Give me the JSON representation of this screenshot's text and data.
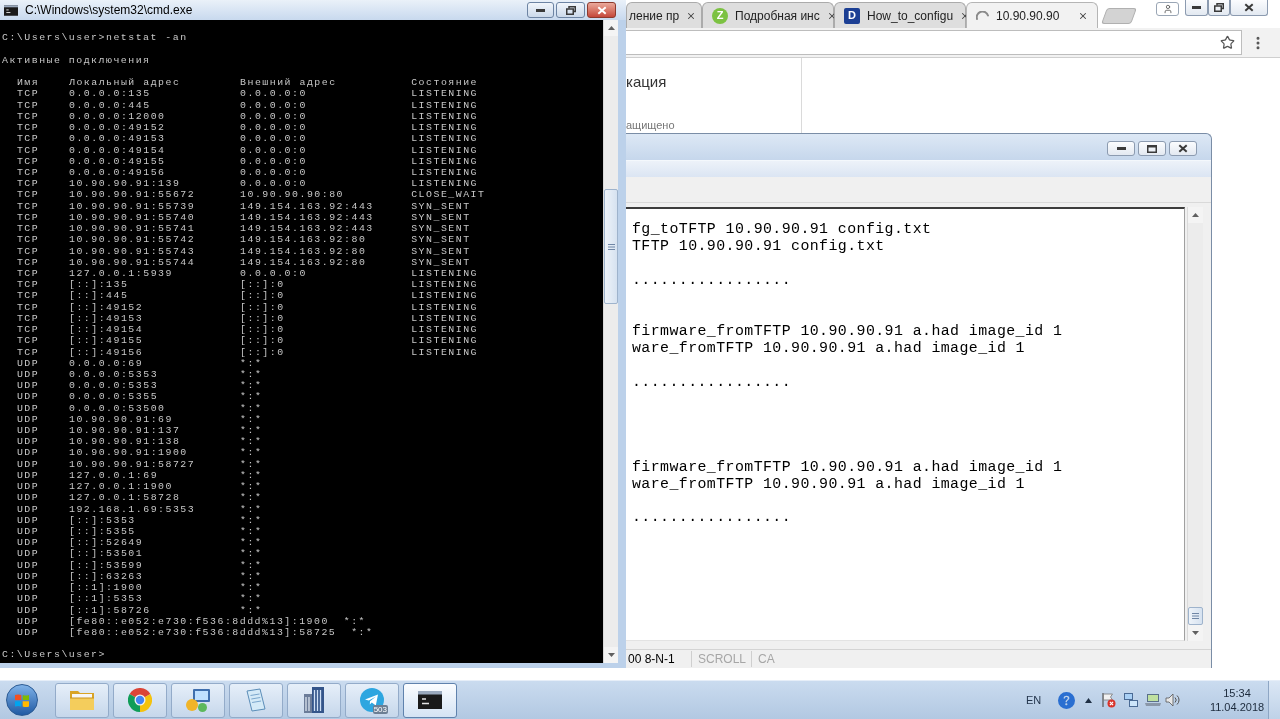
{
  "cmd_window": {
    "title": "C:\\Windows\\system32\\cmd.exe",
    "command": "C:\\Users\\user>netstat -an",
    "heading": "Активные подключения",
    "columns": [
      "Имя",
      "Локальный адрес",
      "Внешний адрес",
      "Состояние"
    ],
    "rows": [
      {
        "proto": "TCP",
        "local": "0.0.0.0:135",
        "foreign": "0.0.0.0:0",
        "state": "LISTENING"
      },
      {
        "proto": "TCP",
        "local": "0.0.0.0:445",
        "foreign": "0.0.0.0:0",
        "state": "LISTENING"
      },
      {
        "proto": "TCP",
        "local": "0.0.0.0:12000",
        "foreign": "0.0.0.0:0",
        "state": "LISTENING"
      },
      {
        "proto": "TCP",
        "local": "0.0.0.0:49152",
        "foreign": "0.0.0.0:0",
        "state": "LISTENING"
      },
      {
        "proto": "TCP",
        "local": "0.0.0.0:49153",
        "foreign": "0.0.0.0:0",
        "state": "LISTENING"
      },
      {
        "proto": "TCP",
        "local": "0.0.0.0:49154",
        "foreign": "0.0.0.0:0",
        "state": "LISTENING"
      },
      {
        "proto": "TCP",
        "local": "0.0.0.0:49155",
        "foreign": "0.0.0.0:0",
        "state": "LISTENING"
      },
      {
        "proto": "TCP",
        "local": "0.0.0.0:49156",
        "foreign": "0.0.0.0:0",
        "state": "LISTENING"
      },
      {
        "proto": "TCP",
        "local": "10.90.90.91:139",
        "foreign": "0.0.0.0:0",
        "state": "LISTENING"
      },
      {
        "proto": "TCP",
        "local": "10.90.90.91:55672",
        "foreign": "10.90.90.90:80",
        "state": "CLOSE_WAIT"
      },
      {
        "proto": "TCP",
        "local": "10.90.90.91:55739",
        "foreign": "149.154.163.92:443",
        "state": "SYN_SENT"
      },
      {
        "proto": "TCP",
        "local": "10.90.90.91:55740",
        "foreign": "149.154.163.92:443",
        "state": "SYN_SENT"
      },
      {
        "proto": "TCP",
        "local": "10.90.90.91:55741",
        "foreign": "149.154.163.92:443",
        "state": "SYN_SENT"
      },
      {
        "proto": "TCP",
        "local": "10.90.90.91:55742",
        "foreign": "149.154.163.92:80",
        "state": "SYN_SENT"
      },
      {
        "proto": "TCP",
        "local": "10.90.90.91:55743",
        "foreign": "149.154.163.92:80",
        "state": "SYN_SENT"
      },
      {
        "proto": "TCP",
        "local": "10.90.90.91:55744",
        "foreign": "149.154.163.92:80",
        "state": "SYN_SENT"
      },
      {
        "proto": "TCP",
        "local": "127.0.0.1:5939",
        "foreign": "0.0.0.0:0",
        "state": "LISTENING"
      },
      {
        "proto": "TCP",
        "local": "[::]:135",
        "foreign": "[::]:0",
        "state": "LISTENING"
      },
      {
        "proto": "TCP",
        "local": "[::]:445",
        "foreign": "[::]:0",
        "state": "LISTENING"
      },
      {
        "proto": "TCP",
        "local": "[::]:49152",
        "foreign": "[::]:0",
        "state": "LISTENING"
      },
      {
        "proto": "TCP",
        "local": "[::]:49153",
        "foreign": "[::]:0",
        "state": "LISTENING"
      },
      {
        "proto": "TCP",
        "local": "[::]:49154",
        "foreign": "[::]:0",
        "state": "LISTENING"
      },
      {
        "proto": "TCP",
        "local": "[::]:49155",
        "foreign": "[::]:0",
        "state": "LISTENING"
      },
      {
        "proto": "TCP",
        "local": "[::]:49156",
        "foreign": "[::]:0",
        "state": "LISTENING"
      },
      {
        "proto": "UDP",
        "local": "0.0.0.0:69",
        "foreign": "*:*"
      },
      {
        "proto": "UDP",
        "local": "0.0.0.0:5353",
        "foreign": "*:*"
      },
      {
        "proto": "UDP",
        "local": "0.0.0.0:5353",
        "foreign": "*:*"
      },
      {
        "proto": "UDP",
        "local": "0.0.0.0:5355",
        "foreign": "*:*"
      },
      {
        "proto": "UDP",
        "local": "0.0.0.0:53500",
        "foreign": "*:*"
      },
      {
        "proto": "UDP",
        "local": "10.90.90.91:69",
        "foreign": "*:*"
      },
      {
        "proto": "UDP",
        "local": "10.90.90.91:137",
        "foreign": "*:*"
      },
      {
        "proto": "UDP",
        "local": "10.90.90.91:138",
        "foreign": "*:*"
      },
      {
        "proto": "UDP",
        "local": "10.90.90.91:1900",
        "foreign": "*:*"
      },
      {
        "proto": "UDP",
        "local": "10.90.90.91:58727",
        "foreign": "*:*"
      },
      {
        "proto": "UDP",
        "local": "127.0.0.1:69",
        "foreign": "*:*"
      },
      {
        "proto": "UDP",
        "local": "127.0.0.1:1900",
        "foreign": "*:*"
      },
      {
        "proto": "UDP",
        "local": "127.0.0.1:58728",
        "foreign": "*:*"
      },
      {
        "proto": "UDP",
        "local": "192.168.1.69:5353",
        "foreign": "*:*"
      },
      {
        "proto": "UDP",
        "local": "[::]:5353",
        "foreign": "*:*"
      },
      {
        "proto": "UDP",
        "local": "[::]:5355",
        "foreign": "*:*"
      },
      {
        "proto": "UDP",
        "local": "[::]:52649",
        "foreign": "*:*"
      },
      {
        "proto": "UDP",
        "local": "[::]:53501",
        "foreign": "*:*"
      },
      {
        "proto": "UDP",
        "local": "[::]:53599",
        "foreign": "*:*"
      },
      {
        "proto": "UDP",
        "local": "[::]:63263",
        "foreign": "*:*"
      },
      {
        "proto": "UDP",
        "local": "[::1]:1900",
        "foreign": "*:*"
      },
      {
        "proto": "UDP",
        "local": "[::1]:5353",
        "foreign": "*:*"
      },
      {
        "proto": "UDP",
        "local": "[::1]:58726",
        "foreign": "*:*"
      },
      {
        "proto": "UDP",
        "local": "[fe80::e052:e730:f536:8ddd%13]:1900",
        "foreign": "*:*"
      },
      {
        "proto": "UDP",
        "local": "[fe80::e052:e730:f536:8ddd%13]:58725",
        "foreign": "*:*"
      }
    ],
    "prompt": "C:\\Users\\user>"
  },
  "browser": {
    "tabs": [
      {
        "title": "ление пр",
        "kind": "plain",
        "selected": false
      },
      {
        "title": "Подробная инс",
        "kind": "favicon",
        "favicon_letter": "Z",
        "color": "#7cc242",
        "selected": false
      },
      {
        "title": "How_to_configu",
        "kind": "favicon",
        "favicon_letter": "D",
        "color": "#1c3f94",
        "selected": false
      },
      {
        "title": "10.90.90.90",
        "kind": "loading",
        "selected": true
      }
    ],
    "page": {
      "heading": "кация",
      "note": "ащищено"
    }
  },
  "terminal_window": {
    "lines": [
      {
        "kind": "text",
        "text": "fg_toTFTP 10.90.90.91 config.txt"
      },
      {
        "kind": "text",
        "text": "TFTP 10.90.90.91 config.txt"
      },
      {
        "kind": "blank"
      },
      {
        "kind": "text",
        "text": "................."
      },
      {
        "kind": "blank"
      },
      {
        "kind": "blank"
      },
      {
        "kind": "text",
        "text": "firmware_fromTFTP 10.90.90.91 a.had image_id 1"
      },
      {
        "kind": "text",
        "text": "ware_fromTFTP 10.90.90.91 a.had image_id 1"
      },
      {
        "kind": "blank"
      },
      {
        "kind": "text",
        "text": "................."
      },
      {
        "kind": "blank"
      },
      {
        "kind": "blank"
      },
      {
        "kind": "blank"
      },
      {
        "kind": "blank"
      },
      {
        "kind": "text",
        "text": "firmware_fromTFTP 10.90.90.91 a.had image_id 1"
      },
      {
        "kind": "text",
        "text": "ware_fromTFTP 10.90.90.91 a.had image_id 1"
      },
      {
        "kind": "blank"
      },
      {
        "kind": "text",
        "text": "................."
      }
    ],
    "status_bar": [
      {
        "text": "00 8-N-1",
        "active": true
      },
      {
        "text": "SCROLL",
        "active": false
      },
      {
        "text": "CA",
        "active": false
      }
    ]
  },
  "taskbar": {
    "apps": [
      {
        "kind": "folder",
        "selected": false
      },
      {
        "kind": "browser",
        "selected": false
      },
      {
        "kind": "network",
        "selected": false
      },
      {
        "kind": "notes",
        "selected": false
      },
      {
        "kind": "building",
        "selected": false
      },
      {
        "kind": "messenger",
        "badge": "503",
        "selected": false
      },
      {
        "kind": "console",
        "selected": true
      }
    ],
    "tray": {
      "language": "EN",
      "time": "15:34",
      "date": "11.04.2018"
    }
  }
}
